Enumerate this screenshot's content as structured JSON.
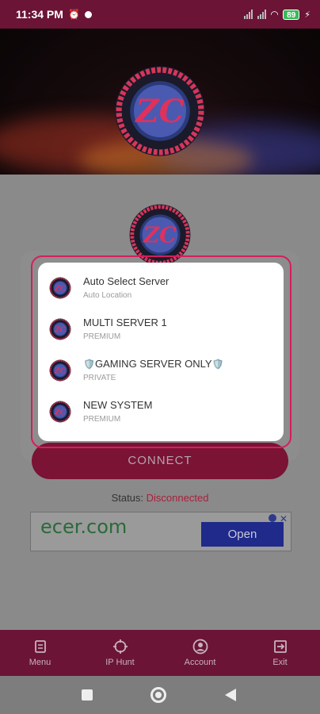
{
  "status_bar": {
    "time": "11:34 PM",
    "alarm_icon": "alarm-icon",
    "battery": "89"
  },
  "main": {
    "connect_label": "CONNECT",
    "status_label": "Status:",
    "status_value": "Disconnected"
  },
  "ad": {
    "brand": "ecer.com",
    "open_label": "Open",
    "close_glyph": "✕"
  },
  "server_dialog": {
    "servers": [
      {
        "name": "Auto Select Server",
        "subtitle": "Auto Location"
      },
      {
        "name": "MULTI SERVER 1",
        "subtitle": "PREMIUM"
      },
      {
        "name": "GAMING SERVER ONLY",
        "subtitle": "PRIVATE"
      },
      {
        "name": "NEW SYSTEM",
        "subtitle": "PREMIUM"
      }
    ]
  },
  "bottom_nav": {
    "items": [
      {
        "label": "Menu",
        "icon": "menu-icon"
      },
      {
        "label": "IP Hunt",
        "icon": "crosshair-icon"
      },
      {
        "label": "Account",
        "icon": "account-icon"
      },
      {
        "label": "Exit",
        "icon": "exit-icon"
      }
    ]
  },
  "colors": {
    "brand": "#6b1436",
    "accent": "#d51e5c",
    "status_disconnected": "#a8213c"
  }
}
